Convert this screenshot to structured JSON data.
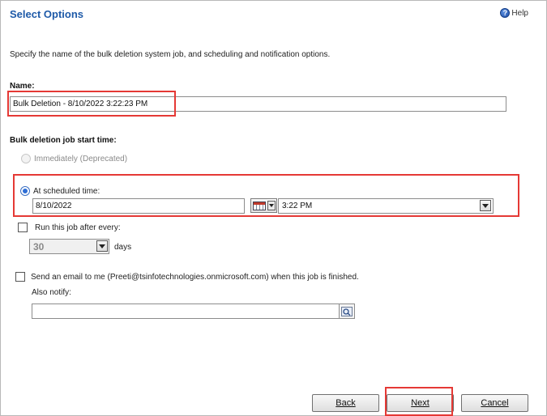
{
  "dialog": {
    "title": "Select Options",
    "help_label": "Help",
    "description": "Specify the name of the bulk deletion system job, and scheduling and notification options."
  },
  "name_section": {
    "label": "Name:",
    "value": "Bulk Deletion - 8/10/2022 3:22:23 PM"
  },
  "start_time": {
    "label": "Bulk deletion job start time:",
    "immediately_label": "Immediately (Deprecated)",
    "scheduled_label": "At scheduled time:",
    "date_value": "8/10/2022",
    "time_value": "3:22 PM"
  },
  "recurrence": {
    "label": "Run this job after every:",
    "interval_value": "30",
    "unit_label": "days"
  },
  "notification": {
    "email_label": "Send an email to me (Preeti@tsinfotechnologies.onmicrosoft.com) when this job is finished.",
    "also_notify_label": "Also notify:",
    "also_notify_value": ""
  },
  "buttons": {
    "back": "Back",
    "next": "Next",
    "cancel": "Cancel"
  },
  "colors": {
    "title": "#1e5aa8",
    "highlight": "#e53935",
    "radio_selected": "#2f6fd6"
  },
  "icons": [
    "help-icon",
    "calendar-icon",
    "chevron-down-icon",
    "lookup-icon"
  ]
}
